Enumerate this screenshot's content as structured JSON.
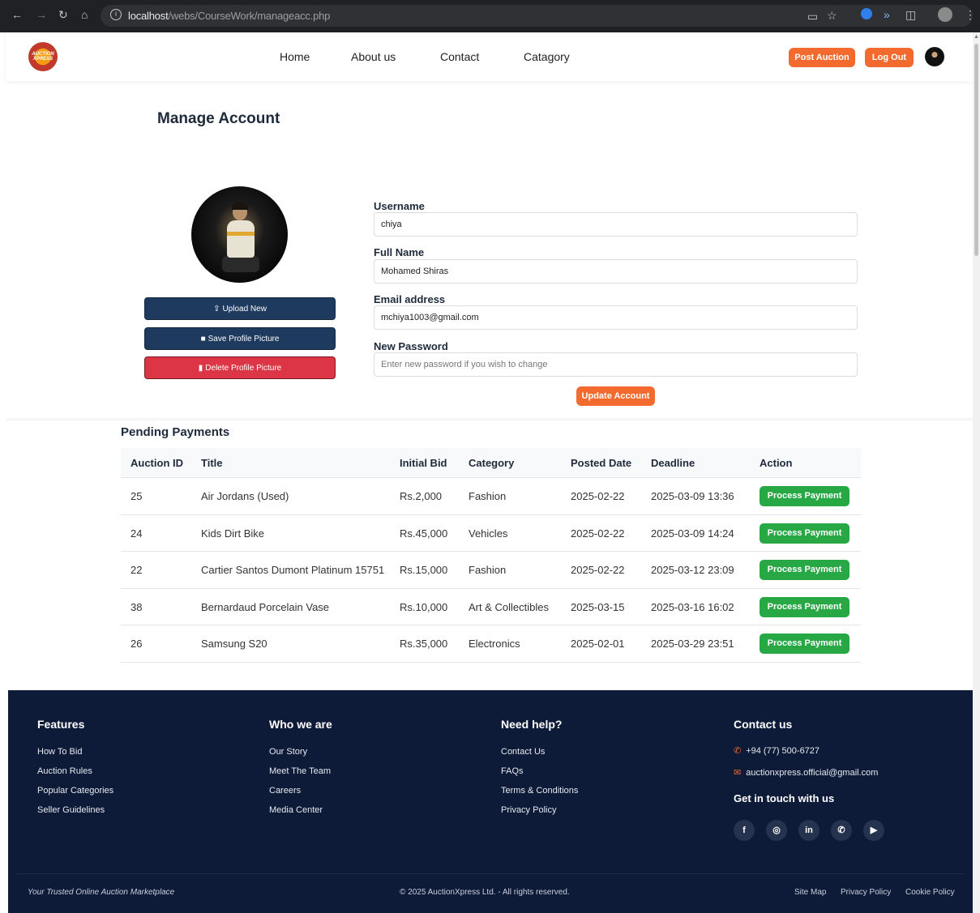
{
  "browser": {
    "url_host": "localhost",
    "url_path": "/webs/CourseWork/manageacc.php"
  },
  "header": {
    "logo_text": "AUCTION XPRESS",
    "nav": [
      "Home",
      "About us",
      "Contact",
      "Catagory"
    ],
    "post_auction": "Post Auction",
    "log_out": "Log Out"
  },
  "account": {
    "title": "Manage Account",
    "upload_new": "Upload New",
    "save_picture": "Save Profile Picture",
    "delete_picture": "Delete Profile Picture",
    "username_label": "Username",
    "username_value": "chiya",
    "fullname_label": "Full Name",
    "fullname_value": "Mohamed Shiras",
    "email_label": "Email address",
    "email_value": "mchiya1003@gmail.com",
    "password_label": "New Password",
    "password_placeholder": "Enter new password if you wish to change",
    "update_button": "Update Account"
  },
  "pending": {
    "title": "Pending Payments",
    "columns": [
      "Auction ID",
      "Title",
      "Initial Bid",
      "Category",
      "Posted Date",
      "Deadline",
      "Action"
    ],
    "rows": [
      {
        "id": "25",
        "title": "Air Jordans (Used)",
        "bid": "Rs.2,000",
        "category": "Fashion",
        "posted": "2025-02-22",
        "deadline": "2025-03-09 13:36",
        "action": "Process Payment"
      },
      {
        "id": "24",
        "title": "Kids Dirt Bike",
        "bid": "Rs.45,000",
        "category": "Vehicles",
        "posted": "2025-02-22",
        "deadline": "2025-03-09 14:24",
        "action": "Process Payment"
      },
      {
        "id": "22",
        "title": "Cartier Santos Dumont Platinum 15751",
        "bid": "Rs.15,000",
        "category": "Fashion",
        "posted": "2025-02-22",
        "deadline": "2025-03-12 23:09",
        "action": "Process Payment"
      },
      {
        "id": "38",
        "title": "Bernardaud Porcelain Vase",
        "bid": "Rs.10,000",
        "category": "Art & Collectibles",
        "posted": "2025-03-15",
        "deadline": "2025-03-16 16:02",
        "action": "Process Payment"
      },
      {
        "id": "26",
        "title": "Samsung S20",
        "bid": "Rs.35,000",
        "category": "Electronics",
        "posted": "2025-02-01",
        "deadline": "2025-03-29 23:51",
        "action": "Process Payment"
      }
    ]
  },
  "footer": {
    "features": {
      "title": "Features",
      "links": [
        "How To Bid",
        "Auction Rules",
        "Popular Categories",
        "Seller Guidelines"
      ]
    },
    "who": {
      "title": "Who we are",
      "links": [
        "Our Story",
        "Meet The Team",
        "Careers",
        "Media Center"
      ]
    },
    "help": {
      "title": "Need help?",
      "links": [
        "Contact Us",
        "FAQs",
        "Terms & Conditions",
        "Privacy Policy"
      ]
    },
    "contact": {
      "title": "Contact us",
      "phone": "+94 (77) 500-6727",
      "email": "auctionxpress.official@gmail.com",
      "touch_title": "Get in touch with us"
    },
    "social": [
      "facebook-icon",
      "instagram-icon",
      "linkedin-icon",
      "whatsapp-icon",
      "youtube-icon"
    ],
    "tagline": "Your Trusted Online Auction Marketplace",
    "copyright": "© 2025 AuctionXpress Ltd. - All rights reserved.",
    "bottom_links": [
      "Site Map",
      "Privacy Policy",
      "Cookie Policy"
    ]
  },
  "colors": {
    "accent": "#f26a2e",
    "navy": "#1f3a5f",
    "danger": "#dc3545",
    "success": "#28a745",
    "footer_bg": "#0d1b38"
  }
}
